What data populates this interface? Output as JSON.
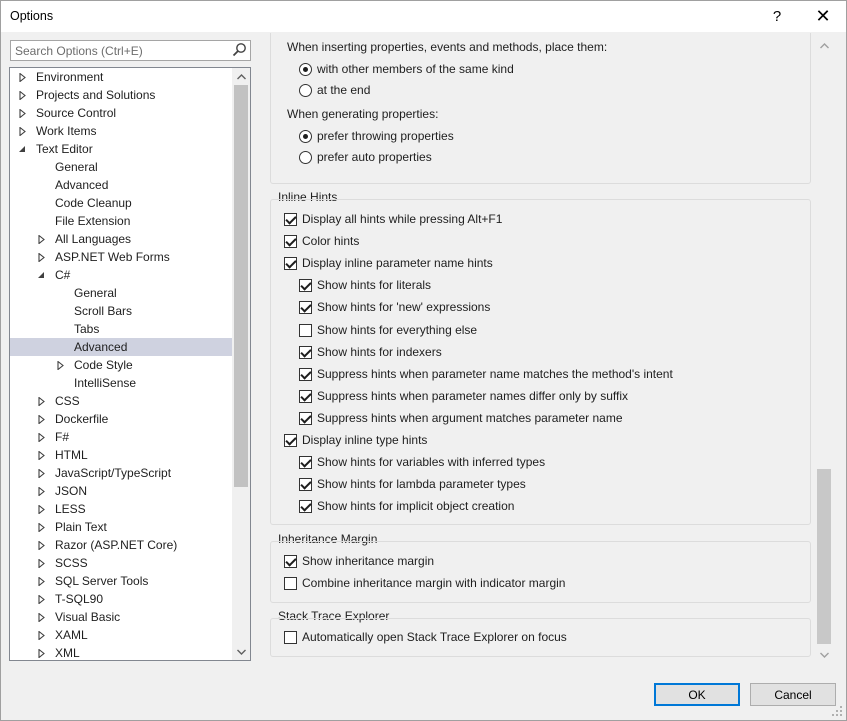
{
  "window": {
    "title": "Options",
    "help_glyph": "?",
    "close_glyph": "✕"
  },
  "search": {
    "placeholder": "Search Options (Ctrl+E)"
  },
  "tree": [
    {
      "label": "Environment",
      "level": 0,
      "state": "collapsed"
    },
    {
      "label": "Projects and Solutions",
      "level": 0,
      "state": "collapsed"
    },
    {
      "label": "Source Control",
      "level": 0,
      "state": "collapsed"
    },
    {
      "label": "Work Items",
      "level": 0,
      "state": "collapsed"
    },
    {
      "label": "Text Editor",
      "level": 0,
      "state": "expanded"
    },
    {
      "label": "General",
      "level": 1,
      "state": "leaf"
    },
    {
      "label": "Advanced",
      "level": 1,
      "state": "leaf"
    },
    {
      "label": "Code Cleanup",
      "level": 1,
      "state": "leaf"
    },
    {
      "label": "File Extension",
      "level": 1,
      "state": "leaf"
    },
    {
      "label": "All Languages",
      "level": 1,
      "state": "collapsed"
    },
    {
      "label": "ASP.NET Web Forms",
      "level": 1,
      "state": "collapsed"
    },
    {
      "label": "C#",
      "level": 1,
      "state": "expanded"
    },
    {
      "label": "General",
      "level": 2,
      "state": "leaf"
    },
    {
      "label": "Scroll Bars",
      "level": 2,
      "state": "leaf"
    },
    {
      "label": "Tabs",
      "level": 2,
      "state": "leaf"
    },
    {
      "label": "Advanced",
      "level": 2,
      "state": "leaf",
      "selected": true
    },
    {
      "label": "Code Style",
      "level": 2,
      "state": "collapsed"
    },
    {
      "label": "IntelliSense",
      "level": 2,
      "state": "leaf"
    },
    {
      "label": "CSS",
      "level": 1,
      "state": "collapsed"
    },
    {
      "label": "Dockerfile",
      "level": 1,
      "state": "collapsed"
    },
    {
      "label": "F#",
      "level": 1,
      "state": "collapsed"
    },
    {
      "label": "HTML",
      "level": 1,
      "state": "collapsed"
    },
    {
      "label": "JavaScript/TypeScript",
      "level": 1,
      "state": "collapsed"
    },
    {
      "label": "JSON",
      "level": 1,
      "state": "collapsed"
    },
    {
      "label": "LESS",
      "level": 1,
      "state": "collapsed"
    },
    {
      "label": "Plain Text",
      "level": 1,
      "state": "collapsed"
    },
    {
      "label": "Razor (ASP.NET Core)",
      "level": 1,
      "state": "collapsed"
    },
    {
      "label": "SCSS",
      "level": 1,
      "state": "collapsed"
    },
    {
      "label": "SQL Server Tools",
      "level": 1,
      "state": "collapsed"
    },
    {
      "label": "T-SQL90",
      "level": 1,
      "state": "collapsed"
    },
    {
      "label": "Visual Basic",
      "level": 1,
      "state": "collapsed"
    },
    {
      "label": "XAML",
      "level": 1,
      "state": "collapsed"
    },
    {
      "label": "XML",
      "level": 1,
      "state": "collapsed"
    }
  ],
  "placement": {
    "insert_label": "When inserting properties, events and methods, place them:",
    "insert_options": [
      {
        "label": "with other members of the same kind",
        "checked": true
      },
      {
        "label": "at the end",
        "checked": false
      }
    ],
    "generate_label": "When generating properties:",
    "generate_options": [
      {
        "label": "prefer throwing properties",
        "checked": true
      },
      {
        "label": "prefer auto properties",
        "checked": false
      }
    ]
  },
  "inline_hints": {
    "title": "Inline Hints",
    "options": [
      {
        "label": "Display all hints while pressing Alt+F1",
        "checked": true,
        "indent": 0
      },
      {
        "label": "Color hints",
        "checked": true,
        "indent": 0
      },
      {
        "label": "Display inline parameter name hints",
        "checked": true,
        "indent": 0
      },
      {
        "label": "Show hints for literals",
        "checked": true,
        "indent": 1
      },
      {
        "label": "Show hints for 'new' expressions",
        "checked": true,
        "indent": 1
      },
      {
        "label": "Show hints for everything else",
        "checked": false,
        "indent": 1
      },
      {
        "label": "Show hints for indexers",
        "checked": true,
        "indent": 1
      },
      {
        "label": "Suppress hints when parameter name matches the method's intent",
        "checked": true,
        "indent": 1
      },
      {
        "label": "Suppress hints when parameter names differ only by suffix",
        "checked": true,
        "indent": 1
      },
      {
        "label": "Suppress hints when argument matches parameter name",
        "checked": true,
        "indent": 1
      },
      {
        "label": "Display inline type hints",
        "checked": true,
        "indent": 0
      },
      {
        "label": "Show hints for variables with inferred types",
        "checked": true,
        "indent": 1
      },
      {
        "label": "Show hints for lambda parameter types",
        "checked": true,
        "indent": 1
      },
      {
        "label": "Show hints for implicit object creation",
        "checked": true,
        "indent": 1
      }
    ]
  },
  "inheritance_margin": {
    "title": "Inheritance Margin",
    "options": [
      {
        "label": "Show inheritance margin",
        "checked": true
      },
      {
        "label": "Combine inheritance margin with indicator margin",
        "checked": false
      }
    ]
  },
  "stack_trace": {
    "title": "Stack Trace Explorer",
    "options": [
      {
        "label": "Automatically open Stack Trace Explorer on focus",
        "checked": false
      }
    ]
  },
  "buttons": {
    "ok": "OK",
    "cancel": "Cancel"
  },
  "colors": {
    "selection": "#cfd2e0",
    "default_button_border": "#0078d7"
  }
}
